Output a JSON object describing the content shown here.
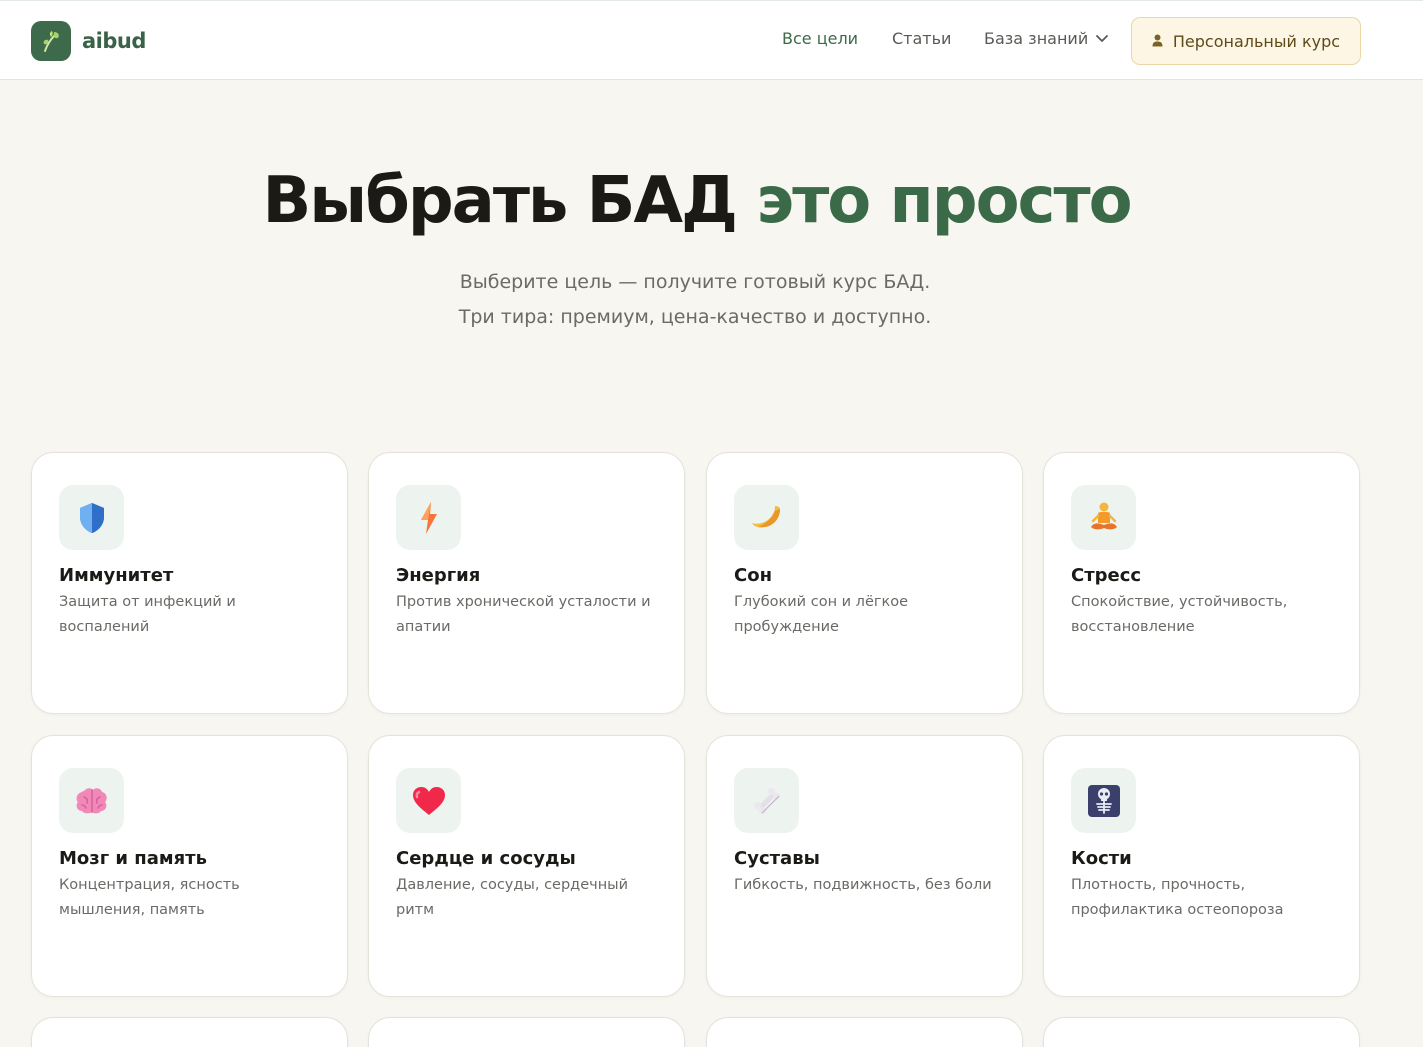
{
  "header": {
    "brand": "aibud",
    "nav": [
      {
        "label": "Все цели"
      },
      {
        "label": "Статьи"
      },
      {
        "label": "База знаний"
      }
    ],
    "cta_label": "Персональный курс"
  },
  "hero": {
    "title_main": "Выбрать БАД",
    "title_accent": "это просто",
    "subtitle_line1": "Выберите цель — получите готовый курс БАД.",
    "subtitle_line2": "Три тира: премиум, цена-качество и доступно."
  },
  "goals": [
    {
      "title": "Иммунитет",
      "desc": "Защита от инфекций и воспалений",
      "icon": "shield-icon"
    },
    {
      "title": "Энергия",
      "desc": "Против хронической усталости и апатии",
      "icon": "lightning-icon"
    },
    {
      "title": "Сон",
      "desc": "Глубокий сон и лёгкое пробуждение",
      "icon": "moon-icon"
    },
    {
      "title": "Стресс",
      "desc": "Спокойствие, устойчивость, восстановление",
      "icon": "meditation-icon"
    },
    {
      "title": "Мозг и память",
      "desc": "Концентрация, ясность мышления, память",
      "icon": "brain-icon"
    },
    {
      "title": "Сердце и сосуды",
      "desc": "Давление, сосуды, сердечный ритм",
      "icon": "heart-icon"
    },
    {
      "title": "Суставы",
      "desc": "Гибкость, подвижность, без боли",
      "icon": "bone-icon"
    },
    {
      "title": "Кости",
      "desc": "Плотность, прочность, профилактика остеопороза",
      "icon": "skeleton-icon"
    }
  ],
  "colors": {
    "accent": "#3a6a48",
    "background": "#f8f6f1",
    "cta_background": "#fdf6e4"
  }
}
